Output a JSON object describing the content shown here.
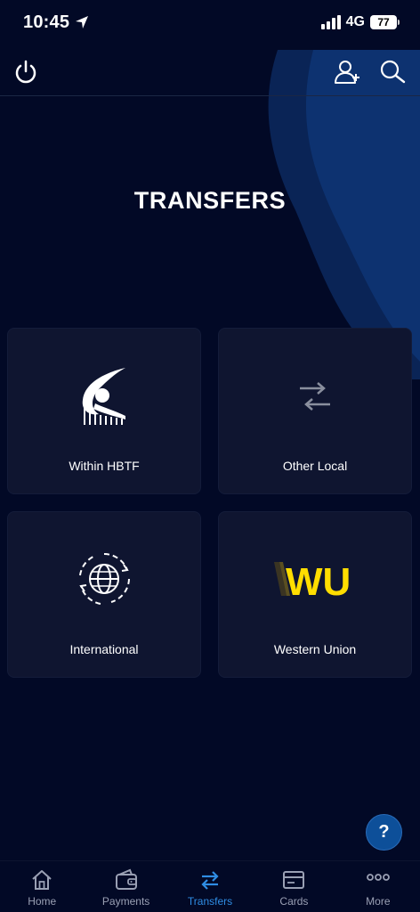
{
  "status_bar": {
    "time": "10:45",
    "network": "4G",
    "battery": "77"
  },
  "page": {
    "title": "TRANSFERS"
  },
  "tiles": [
    {
      "label": "Within HBTF",
      "icon": "hbtf-logo-icon"
    },
    {
      "label": "Other Local",
      "icon": "swap-arrows-icon"
    },
    {
      "label": "International",
      "icon": "globe-icon"
    },
    {
      "label": "Western Union",
      "icon": "western-union-logo",
      "logo_text": "WU"
    }
  ],
  "help": {
    "label": "?"
  },
  "tab_bar": {
    "tabs": [
      {
        "label": "Home",
        "icon": "home-icon"
      },
      {
        "label": "Payments",
        "icon": "wallet-icon"
      },
      {
        "label": "Transfers",
        "icon": "transfer-icon",
        "active": true
      },
      {
        "label": "Cards",
        "icon": "card-icon"
      },
      {
        "label": "More",
        "icon": "more-dots-icon"
      }
    ]
  },
  "colors": {
    "background": "#020926",
    "tile": "#0f1530",
    "accent": "#2f8de4",
    "wu_yellow": "#ffdd00"
  }
}
